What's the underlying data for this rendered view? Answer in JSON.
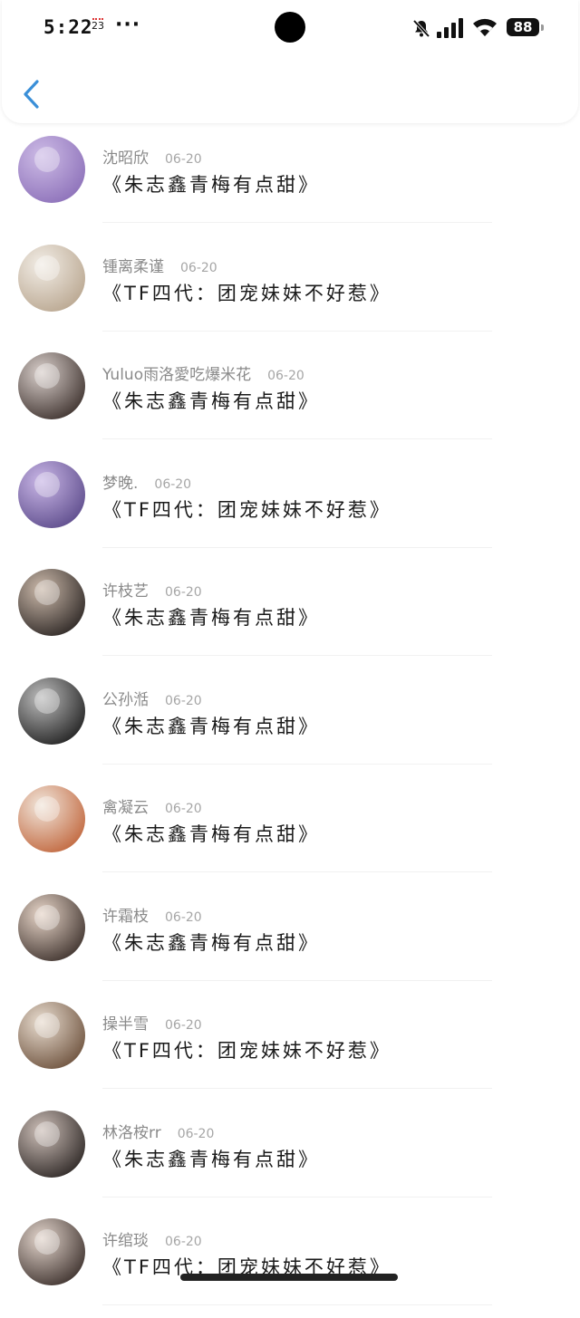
{
  "status_bar": {
    "time": "5:22",
    "calendar_day": "23",
    "more": "···",
    "battery": "88"
  },
  "colors": {
    "accent": "#3a8fd8",
    "divider": "#f1f1f1"
  },
  "icons": [
    "back-chevron-icon",
    "bell-muted-icon",
    "signal-icon",
    "wifi-icon",
    "battery-icon",
    "calendar-icon"
  ],
  "items": [
    {
      "name": "沈昭欣",
      "date": "06-20",
      "title": "《朱志鑫青梅有点甜》",
      "avatar": [
        "#8b6fb8",
        "#cdbbe6"
      ]
    },
    {
      "name": "锺离柔谨",
      "date": "06-20",
      "title": "《TF四代：团宠妹妹不好惹》",
      "avatar": [
        "#b8a58e",
        "#f2ede6"
      ]
    },
    {
      "name": "Yuluo雨洛愛吃爆米花",
      "date": "06-20",
      "title": "《朱志鑫青梅有点甜》",
      "avatar": [
        "#3b2f2b",
        "#d9cfcb"
      ]
    },
    {
      "name": "梦晚.",
      "date": "06-20",
      "title": "《TF四代：团宠妹妹不好惹》",
      "avatar": [
        "#5b4a8a",
        "#c9b6e6"
      ]
    },
    {
      "name": "许枝艺",
      "date": "06-20",
      "title": "《朱志鑫青梅有点甜》",
      "avatar": [
        "#2a2422",
        "#cbb9aa"
      ]
    },
    {
      "name": "公孙湉",
      "date": "06-20",
      "title": "《朱志鑫青梅有点甜》",
      "avatar": [
        "#1e1e1e",
        "#bdbdbd"
      ]
    },
    {
      "name": "禽凝云",
      "date": "06-20",
      "title": "《朱志鑫青梅有点甜》",
      "avatar": [
        "#c0643a",
        "#f1e6db"
      ]
    },
    {
      "name": "许霜枝",
      "date": "06-20",
      "title": "《朱志鑫青梅有点甜》",
      "avatar": [
        "#3b2f2a",
        "#e7d5c8"
      ]
    },
    {
      "name": "操半雪",
      "date": "06-20",
      "title": "《TF四代：团宠妹妹不好惹》",
      "avatar": [
        "#6b4f3a",
        "#e9ddd0"
      ]
    },
    {
      "name": "林洛桉rr",
      "date": "06-20",
      "title": "《朱志鑫青梅有点甜》",
      "avatar": [
        "#2b2523",
        "#cdbfb8"
      ]
    },
    {
      "name": "许绾琰",
      "date": "06-20",
      "title": "《TF四代：团宠妹妹不好惹》",
      "avatar": [
        "#3a2e2a",
        "#e3d5cc"
      ]
    }
  ]
}
